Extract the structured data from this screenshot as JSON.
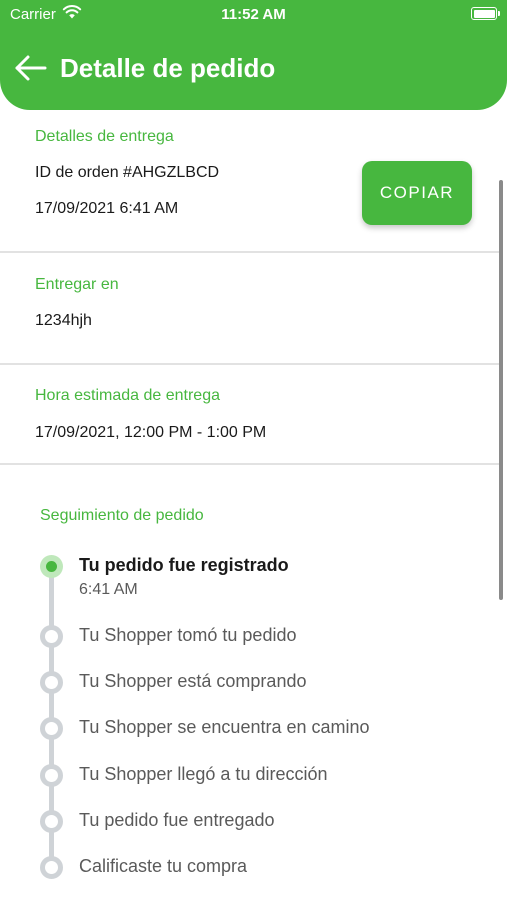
{
  "status_bar": {
    "carrier": "Carrier",
    "time": "11:52 AM"
  },
  "header": {
    "title": "Detalle de pedido"
  },
  "delivery_details": {
    "label": "Detalles de entrega",
    "order_id": "ID de orden #AHGZLBCD",
    "datetime": "17/09/2021 6:41 AM",
    "copy_label": "COPIAR"
  },
  "deliver_to": {
    "label": "Entregar en",
    "value": "1234hjh"
  },
  "estimated_time": {
    "label": "Hora estimada de entrega",
    "value": "17/09/2021, 12:00 PM - 1:00 PM"
  },
  "tracking": {
    "label": "Seguimiento de pedido",
    "steps": [
      {
        "label": "Tu pedido fue registrado",
        "time": "6:41 AM",
        "status": "active"
      },
      {
        "label": "Tu Shopper tomó tu pedido",
        "status": "pending"
      },
      {
        "label": "Tu Shopper está comprando",
        "status": "pending"
      },
      {
        "label": "Tu Shopper se encuentra en camino",
        "status": "pending"
      },
      {
        "label": "Tu Shopper llegó a tu dirección",
        "status": "pending"
      },
      {
        "label": "Tu pedido fue entregado",
        "status": "pending"
      },
      {
        "label": "Calificaste tu compra",
        "status": "pending"
      }
    ]
  },
  "colors": {
    "accent": "#47b73f",
    "timeline_inactive": "#cfd3d7",
    "active_dot_halo": "#bfe8bb"
  }
}
